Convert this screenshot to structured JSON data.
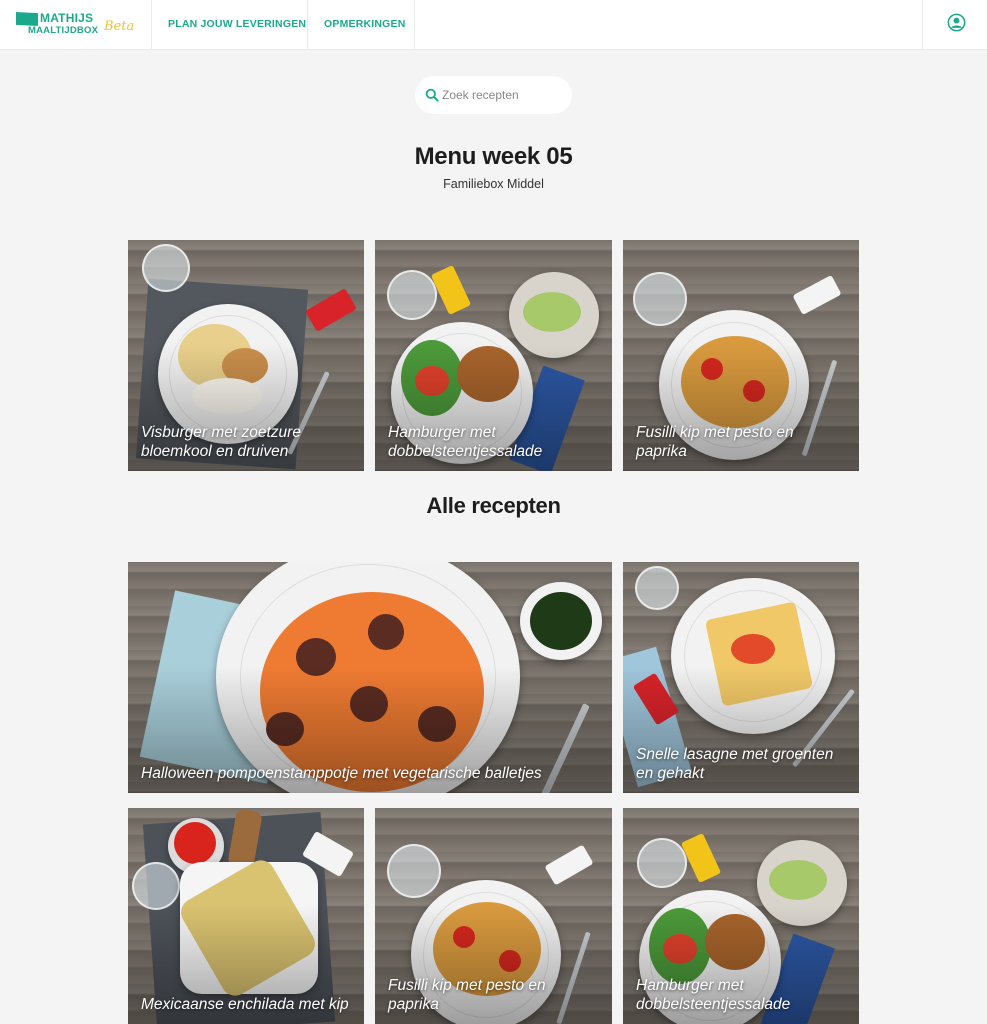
{
  "header": {
    "logo_line1": "MATHIJS",
    "logo_line2": "MAALTIJDBOX",
    "logo_badge": "Beta",
    "nav": [
      "PLAN JOUW LEVERINGEN",
      "OPMERKINGEN"
    ]
  },
  "search": {
    "placeholder": "Zoek recepten"
  },
  "menu": {
    "title": "Menu week 05",
    "subtitle": "Familiebox Middel",
    "recipes": [
      "Visburger met zoetzure bloemkool en druiven",
      "Hamburger met dobbelsteentjessalade",
      "Fusilli kip met pesto en paprika"
    ]
  },
  "all": {
    "title": "Alle recepten",
    "recipes": [
      "Halloween pompoenstamppotje met vegetarische balletjes",
      "Snelle lasagne met groenten en gehakt",
      "Mexicaanse enchilada met kip",
      "Fusilli kip met pesto en paprika",
      "Hamburger met dobbelsteentjessalade"
    ]
  },
  "colors": {
    "brand": "#1aaa8b",
    "beta": "#f1c232",
    "background": "#f4f4f4"
  },
  "icons": {
    "search": "search-icon",
    "account": "user-icon",
    "logo": "logo-flag-icon"
  }
}
